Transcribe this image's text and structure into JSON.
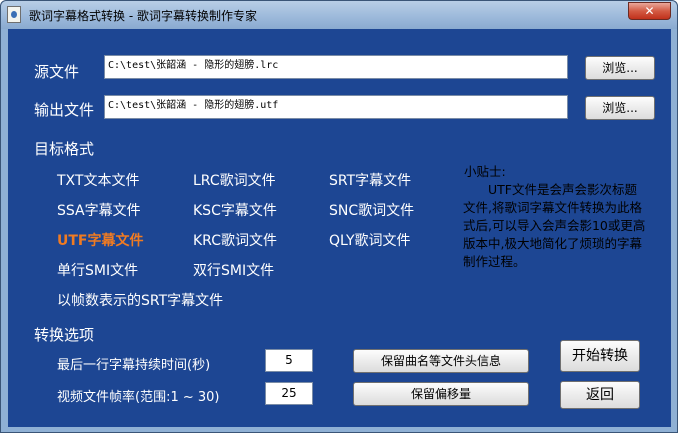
{
  "window": {
    "title": "歌词字幕格式转换 - 歌词字幕转换制作专家",
    "close_glyph": "✕"
  },
  "source": {
    "label": "源文件",
    "value": "C:\\test\\张韶涵 - 隐形的翅膀.lrc",
    "browse": "浏览..."
  },
  "output": {
    "label": "输出文件",
    "value": "C:\\test\\张韶涵 - 隐形的翅膀.utf",
    "browse": "浏览..."
  },
  "target_format": {
    "title": "目标格式",
    "items": [
      "TXT文本文件",
      "LRC歌词文件",
      "SRT字幕文件",
      "SSA字幕文件",
      "KSC字幕文件",
      "SNC歌词文件",
      "UTF字幕文件",
      "KRC歌词文件",
      "QLY歌词文件",
      "单行SMI文件",
      "双行SMI文件",
      "以帧数表示的SRT字幕文件"
    ],
    "selected": "UTF字幕文件",
    "active_color": "#f07b22"
  },
  "tip": {
    "title": "小贴士:",
    "text": "UTF文件是会声会影次标题文件,将歌词字幕文件转换为此格式后,可以导入会声会影10或更高版本中,极大地简化了烦琐的字幕制作过程。"
  },
  "options": {
    "title": "转换选项",
    "last_line_label": "最后一行字幕持续时间(秒)",
    "last_line_value": "5",
    "fps_label": "视频文件帧率(范围:1 ~ 30)",
    "fps_value": "25",
    "keep_header": "保留曲名等文件头信息",
    "keep_offset": "保留偏移量"
  },
  "actions": {
    "start": "开始转换",
    "back": "返回"
  }
}
